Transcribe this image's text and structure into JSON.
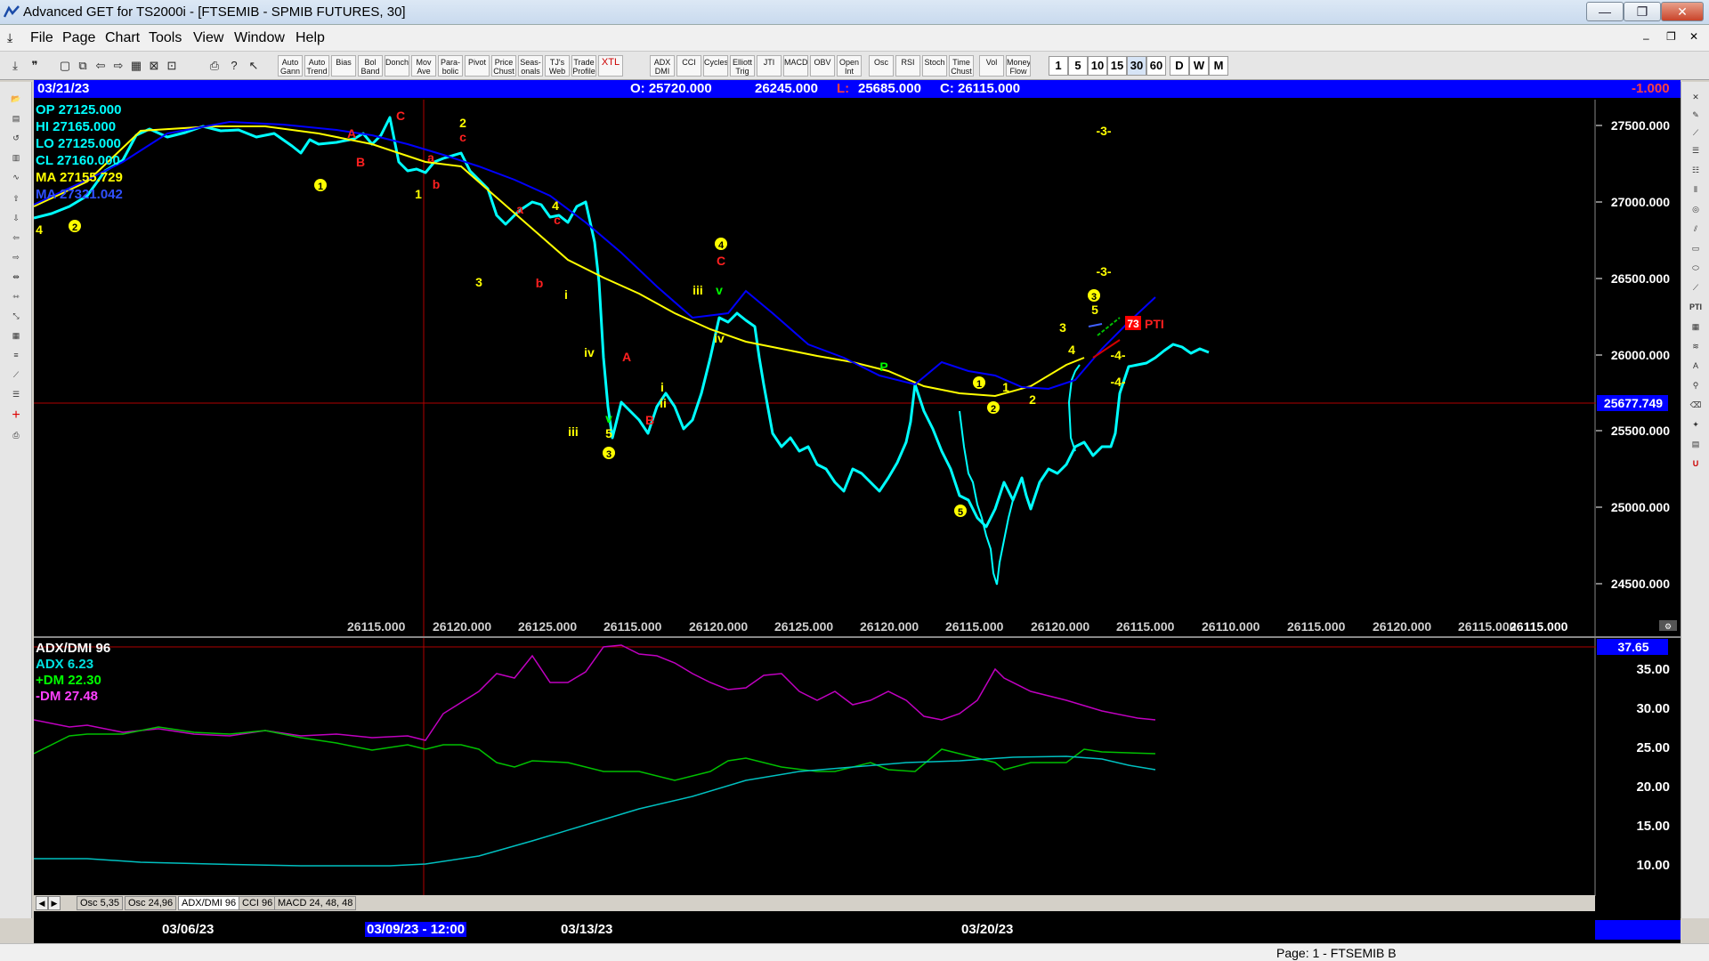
{
  "window": {
    "title": "Advanced GET for TS2000i - [FTSEMIB - SPMIB FUTURES, 30]",
    "minimize": "—",
    "restore": "❐",
    "close": "✕"
  },
  "menu": [
    "File",
    "Page",
    "Chart",
    "Tools",
    "View",
    "Window",
    "Help"
  ],
  "toolbar": {
    "studies": [
      "Auto Gann",
      "Auto Trend",
      "Bias",
      "Bol Band",
      "Donch",
      "Mov Ave",
      "Para- bolic",
      "Pivot",
      "Price Chust",
      "Seas- onals",
      "TJ's Web",
      "Trade Profile",
      "XTL",
      "ADX DMI",
      "CCI",
      "Cycles",
      "Elliott Trig",
      "JTI",
      "MACD",
      "OBV",
      "Open Int",
      "Osc",
      "RSI",
      "Stoch",
      "Time Chust",
      "Vol",
      "Money Flow"
    ],
    "timeframes": [
      "1",
      "5",
      "10",
      "15",
      "30",
      "60",
      "D",
      "W",
      "M"
    ],
    "selected_timeframe": "30"
  },
  "infobar": {
    "date": "03/21/23",
    "open": "O: 25720.000",
    "high": "26245.000",
    "low_label": "L:",
    "low": "25685.000",
    "close": "C: 26115.000",
    "change": "-1.000"
  },
  "legend": {
    "op": "OP 27125.000",
    "hi": "HI  27165.000",
    "lo": "LO  27125.000",
    "cl": "CL  27160.000",
    "ma1": "MA  27155.729",
    "ma2": "MA  27321.042"
  },
  "price_axis": {
    "ticks": [
      "27500.000",
      "27000.000",
      "26500.000",
      "26000.000",
      "25500.000",
      "25000.000",
      "24500.000"
    ],
    "cursor_price": "25677.749"
  },
  "pivot_labels": [
    "26115.000",
    "26120.000",
    "26125.000",
    "26115.000",
    "26120.000",
    "26125.000",
    "26120.000",
    "26115.000",
    "26120.000",
    "26115.000",
    "26110.000",
    "26115.000",
    "26120.000",
    "26115.000"
  ],
  "pivot_last": "26115.000",
  "pti": {
    "value": "73",
    "label": "PTI"
  },
  "waves": {
    "w1": "1",
    "w2": "2",
    "w3": "3",
    "w4": "4",
    "w5": "5",
    "A": "A",
    "B": "B",
    "C": "C",
    "a": "a",
    "b": "b",
    "c": "c",
    "i": "i",
    "ii": "ii",
    "iii": "iii",
    "iv": "iv",
    "v": "v",
    "P": "P",
    "m3": "-3-",
    "m4": "-4-"
  },
  "osc": {
    "title": "ADX/DMI 96",
    "adx": "ADX 6.23",
    "pdm": "+DM 22.30",
    "mdm": "-DM  27.48",
    "axis": [
      "35.00",
      "30.00",
      "25.00",
      "20.00",
      "15.00",
      "10.00"
    ],
    "cursor": "37.65"
  },
  "tabs": [
    "Osc 5,35",
    "Osc 24,96",
    "ADX/DMI 96",
    "CCI 96",
    "MACD 24, 48, 48"
  ],
  "active_tab": "ADX/DMI 96",
  "dates": [
    "03/06/23",
    "03/09/23 - 12:00",
    "03/13/23",
    "03/20/23"
  ],
  "status": "Page: 1 - FTSEMIB B",
  "colors": {
    "bars": "#00ffff",
    "ma_fast": "#ffff00",
    "ma_slow": "#0000ff",
    "wave_yellow": "#ffff00",
    "wave_red": "#ff0000",
    "wave_green": "#00ff00",
    "adx": "#00c0c0",
    "pdm": "#00c000",
    "mdm": "#c000c0"
  }
}
